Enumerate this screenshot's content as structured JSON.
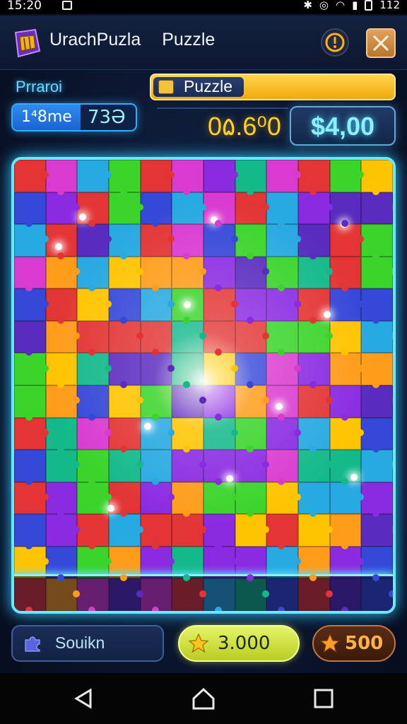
{
  "status_bar": {
    "time": "15:20",
    "right_text": "112"
  },
  "header": {
    "app_name": "UrachPuzla",
    "section_title": "Puzzle"
  },
  "info": {
    "player_label": "Prraroi",
    "mode_label": "Puzzle",
    "time_label": "1⁴8me",
    "time_value": "73Ə",
    "score": "0۵.6⁰0",
    "money": "$4,00"
  },
  "bottom": {
    "search_label": "Souikn",
    "coins": "3.000",
    "gems": "500"
  },
  "colors": {
    "accent_cyan": "#6be7ff",
    "gold": "#ffd31d",
    "piece_palette": [
      "#8a2be2",
      "#27a9e1",
      "#3ad42a",
      "#ff9c1a",
      "#e33535",
      "#d93bd0",
      "#3648d8",
      "#ffc400",
      "#14b98a",
      "#5a2bbf"
    ]
  },
  "icons": [
    "logo-icon",
    "alert-icon",
    "close-icon",
    "puzzle-icon",
    "puzzle-piece-icon",
    "star-icon",
    "back-icon",
    "home-icon",
    "recent-apps-icon"
  ]
}
